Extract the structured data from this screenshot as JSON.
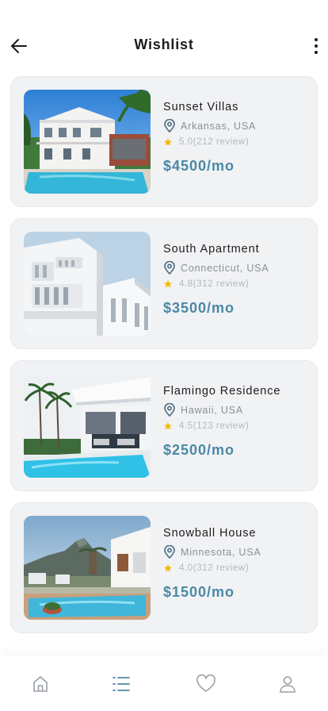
{
  "header": {
    "title": "Wishlist",
    "back_icon": "arrow-left-icon",
    "menu_icon": "more-vertical-icon"
  },
  "listings": [
    {
      "name": "Sunset Villas",
      "location": "Arkansas, USA",
      "rating": "5.0(212 review)",
      "price": "$4500/mo",
      "image": "white colonial villa with pool"
    },
    {
      "name": "South Apartment",
      "location": "Connecticut, USA",
      "rating": "4.8(312 review)",
      "price": "$3500/mo",
      "image": "white modern apartment building"
    },
    {
      "name": "Flamingo Residence",
      "location": "Hawaii, USA",
      "rating": "4.5(123 review)",
      "price": "$2500/mo",
      "image": "modern house with pool and palms"
    },
    {
      "name": "Snowball House",
      "location": "Minnesota, USA",
      "rating": "4.0(312 review)",
      "price": "$1500/mo",
      "image": "villa pool with mountain view"
    }
  ],
  "nav": [
    {
      "icon": "home-icon",
      "active": false
    },
    {
      "icon": "list-icon",
      "active": true
    },
    {
      "icon": "heart-icon",
      "active": false
    },
    {
      "icon": "user-icon",
      "active": false
    }
  ],
  "colors": {
    "accent": "#4a88a6",
    "card_bg": "#f1f2f4",
    "star": "#f5b800",
    "muted_text": "#8a8f96"
  }
}
